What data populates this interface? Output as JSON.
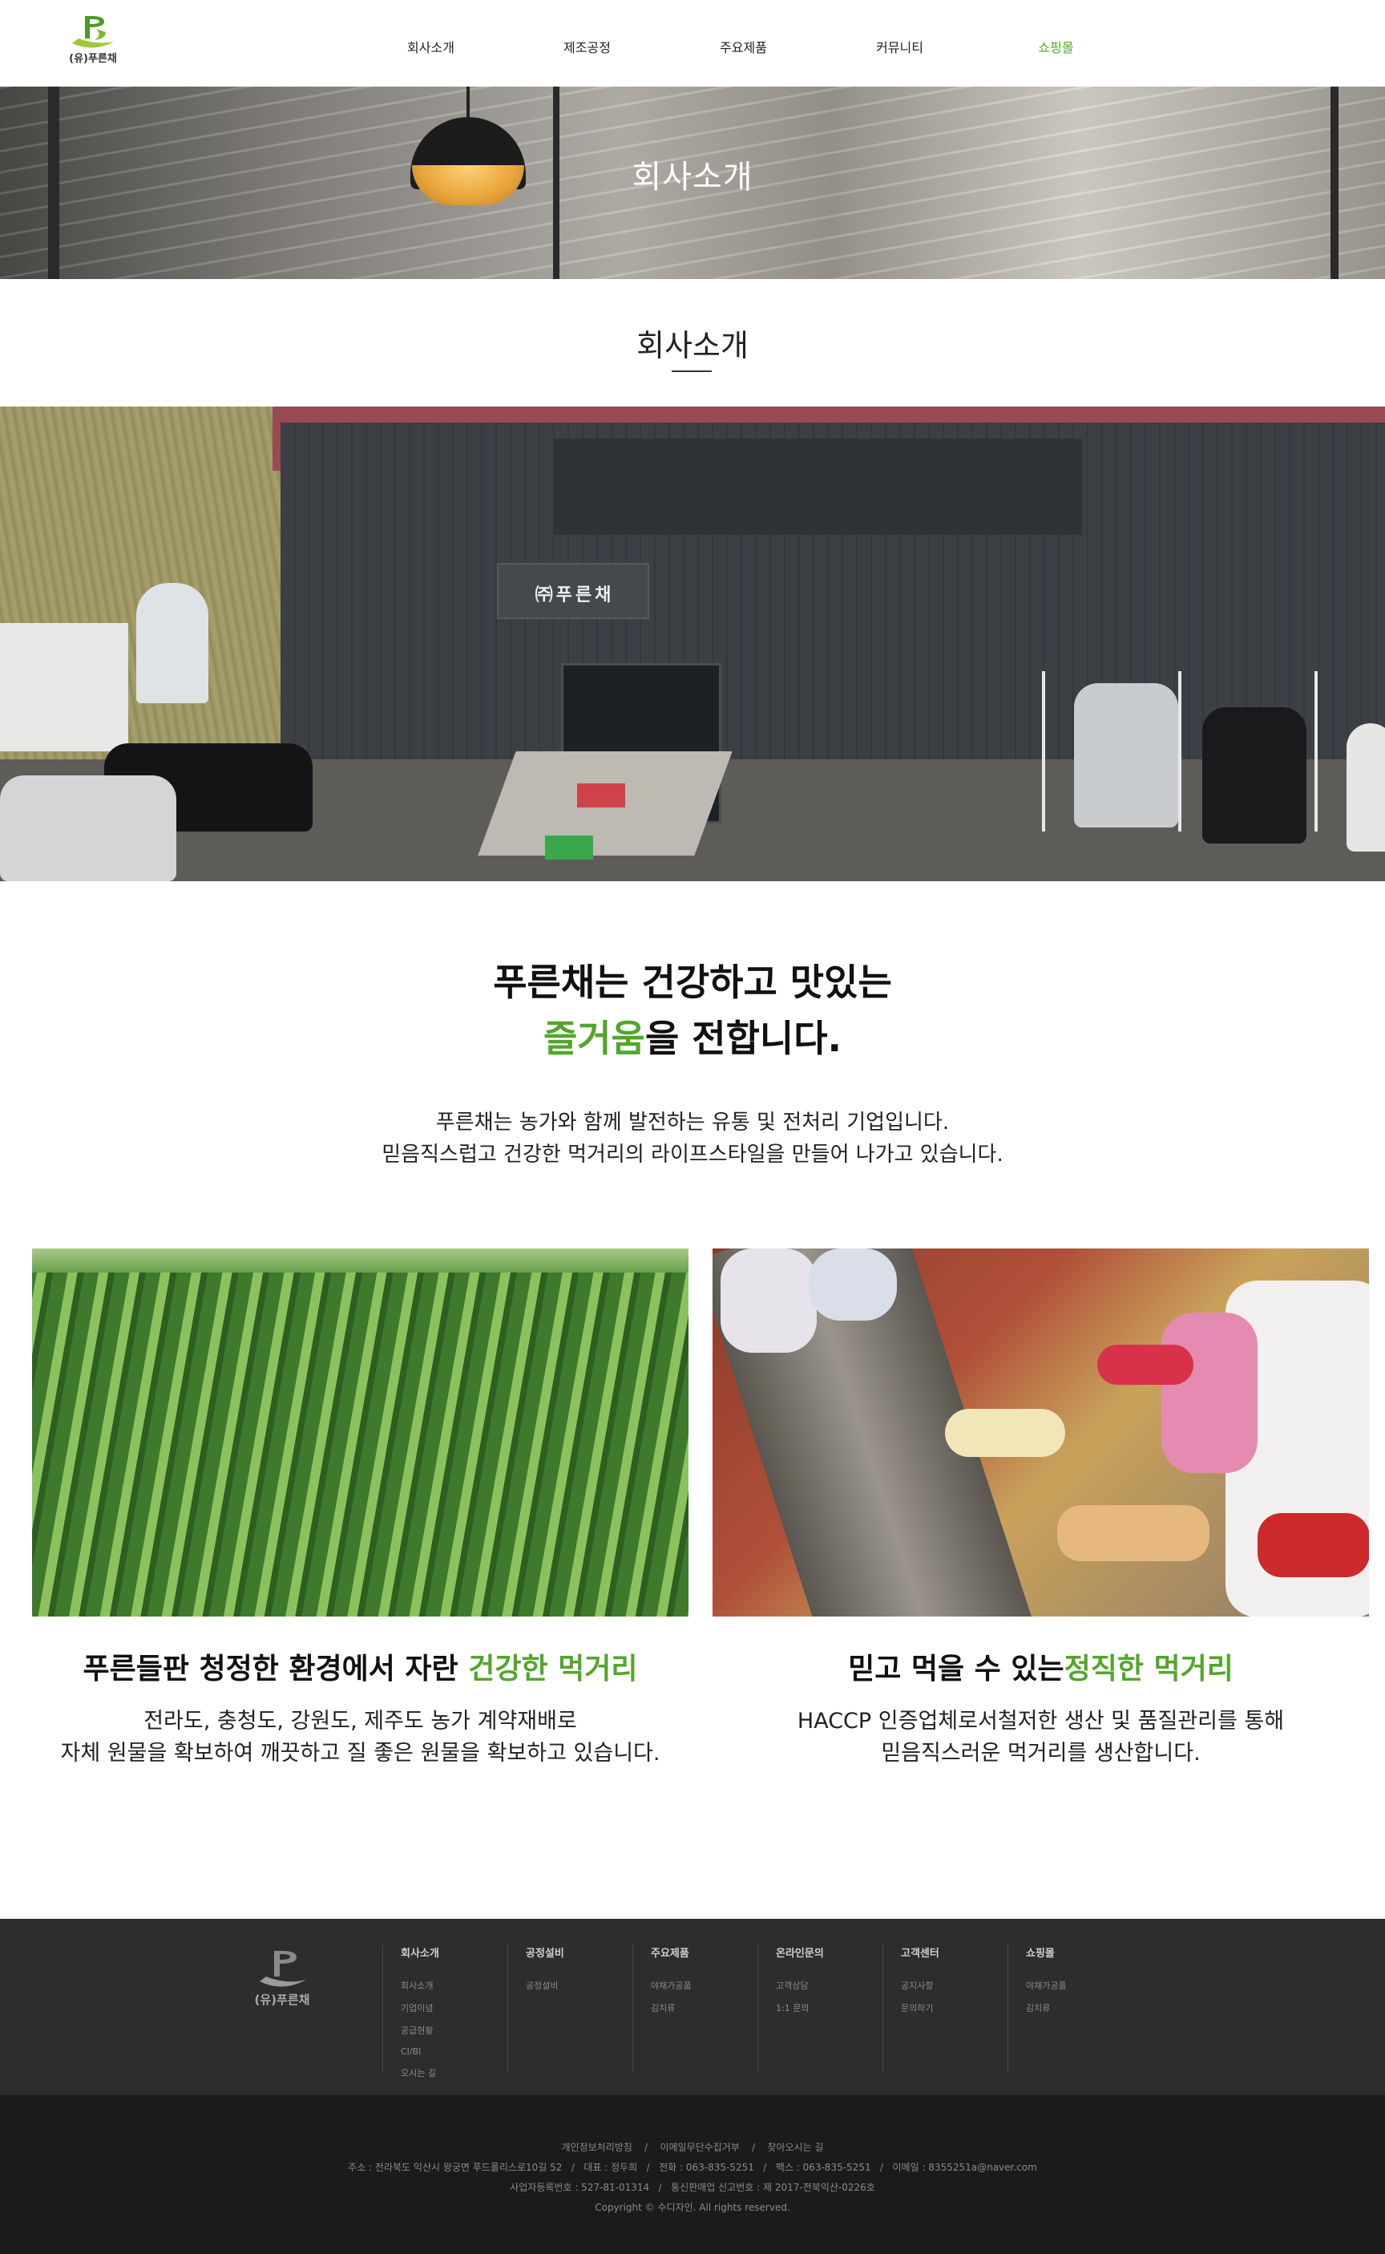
{
  "header": {
    "logo_text": "(유)푸른채",
    "nav": [
      {
        "label": "회사소개"
      },
      {
        "label": "제조공정"
      },
      {
        "label": "주요제품"
      },
      {
        "label": "커뮤니티"
      },
      {
        "label": "쇼핑몰"
      }
    ],
    "active_nav": "쇼핑몰"
  },
  "hero": {
    "title": "회사소개"
  },
  "section": {
    "title": "회사소개"
  },
  "factory_photo": {
    "sign_text": "㈜푸른채"
  },
  "slogan": {
    "line1": "푸른채는 건강하고 맛있는",
    "line2_accent": "즐거움",
    "line2_rest": "을 전합니다."
  },
  "intro": {
    "line1": "푸른채는 농가와 함께 발전하는 유통 및 전처리 기업입니다.",
    "line2": "믿음직스럽고 건강한 먹거리의 라이프스타일을 만들어 나가고 있습니다."
  },
  "cards": [
    {
      "title_plain": "푸른들판 청정한 환경에서 자란 ",
      "title_accent": "건강한 먹거리",
      "desc_line1": "전라도, 충청도, 강원도, 제주도 농가 계약재배로",
      "desc_line2": "자체 원물을 확보하여 깨끗하고 질 좋은 원물을 확보하고 있습니다."
    },
    {
      "title_plain": "믿고 먹을 수 있는",
      "title_accent": "정직한 먹거리",
      "desc_line1": "HACCP 인증업체로서철저한 생산 및 품질관리를 통해",
      "desc_line2": "믿음직스러운 먹거리를 생산합니다."
    }
  ],
  "footer": {
    "logo_text": "(유)푸른채",
    "columns": [
      {
        "title": "회사소개",
        "links": [
          "회사소개",
          "기업이념",
          "공급현황",
          "CI/BI",
          "오시는 길"
        ]
      },
      {
        "title": "공정설비",
        "links": [
          "공정설비"
        ]
      },
      {
        "title": "주요제품",
        "links": [
          "야채가공품",
          "김치류"
        ]
      },
      {
        "title": "온라인문의",
        "links": [
          "고객상담",
          "1:1 문의"
        ]
      },
      {
        "title": "고객센터",
        "links": [
          "공지사항",
          "문의하기"
        ]
      },
      {
        "title": "쇼핑몰",
        "links": [
          "야채가공품",
          "김치류"
        ]
      }
    ],
    "bottom_links": [
      "개인정보처리방침",
      "이메일무단수집거부",
      "찾아오시는 길"
    ],
    "address_line": "주소 : 전라북도 익산시 왕궁면 푸드폴리스로10길 52   /   대표 : 정두희   /   전화 : 063-835-5251   /   팩스 : 063-835-5251   /   이메일 : 8355251a@naver.com",
    "business_line": "사업자등록번호 : 527-81-01314   /   통신판매업 신고번호 : 제 2017-전북익산-0226호",
    "copyright": "Copyright © 수디자인. All rights reserved."
  },
  "colors": {
    "accent": "#52a62c",
    "footer_top_bg": "#2d2d2d",
    "footer_bottom_bg": "#1b1b1b"
  }
}
